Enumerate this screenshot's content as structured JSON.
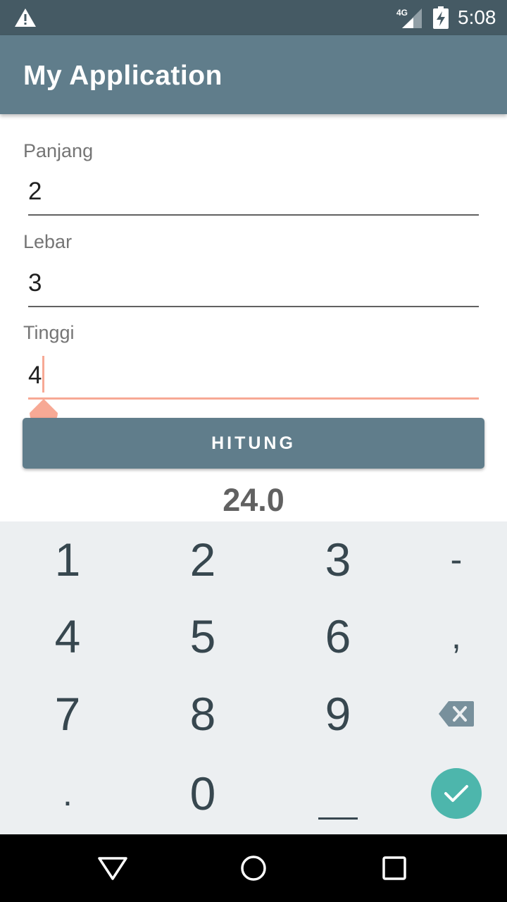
{
  "status_bar": {
    "time": "5:08",
    "network": "4G",
    "icons": [
      "warning-icon",
      "signal-icon",
      "battery-charging-icon"
    ]
  },
  "app_bar": {
    "title": "My Application"
  },
  "form": {
    "panjang": {
      "label": "Panjang",
      "value": "2"
    },
    "lebar": {
      "label": "Lebar",
      "value": "3"
    },
    "tinggi": {
      "label": "Tinggi",
      "value": "4"
    },
    "button_label": "HITUNG",
    "result": "24.0"
  },
  "keyboard": {
    "keys": [
      [
        "1",
        "2",
        "3",
        "-"
      ],
      [
        "4",
        "5",
        "6",
        ","
      ],
      [
        "7",
        "8",
        "9",
        "backspace-icon"
      ],
      [
        ".",
        "0",
        "space-icon",
        "done-icon"
      ]
    ]
  },
  "nav_bar": {
    "icons": [
      "back-icon",
      "home-icon",
      "recents-icon"
    ]
  },
  "colors": {
    "status_bar": "#455a64",
    "app_bar": "#607d8b",
    "accent": "#f7a995",
    "keyboard_bg": "#eceff1",
    "enter_key": "#4db6ac"
  }
}
